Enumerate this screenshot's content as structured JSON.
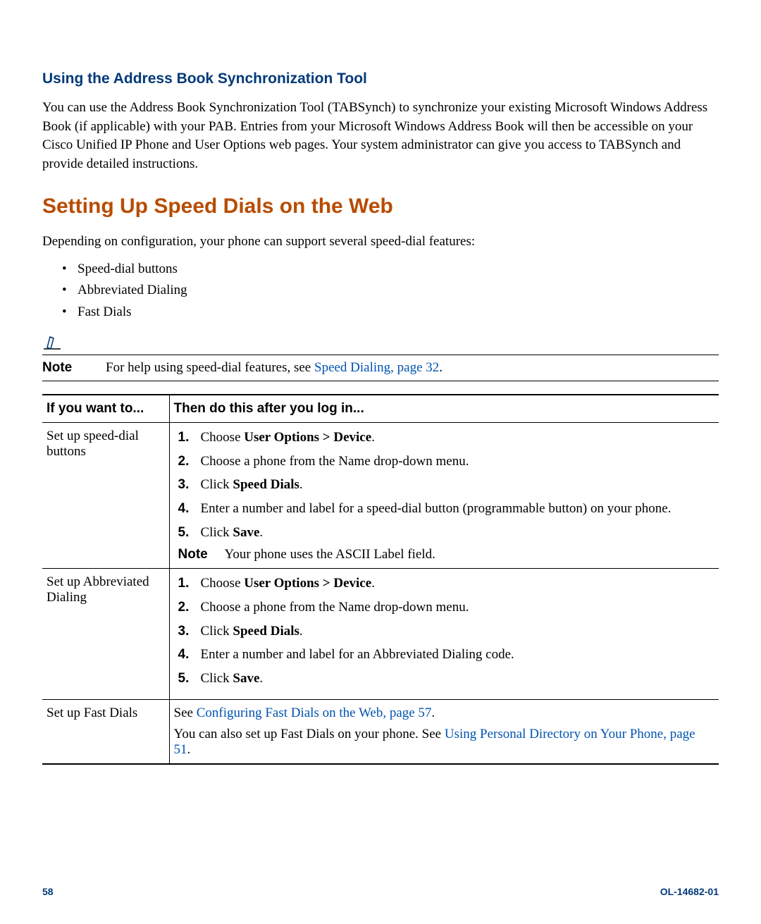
{
  "section1": {
    "title": "Using the Address Book Synchronization Tool",
    "body": "You can use the Address Book Synchronization Tool (TABSynch) to synchronize your existing Microsoft Windows Address Book (if applicable) with your PAB. Entries from your Microsoft Windows Address Book will then be accessible on your Cisco Unified IP Phone and User Options web pages. Your system administrator can give you access to TABSynch and provide detailed instructions."
  },
  "section2": {
    "title": "Setting Up Speed Dials on the Web",
    "lead": "Depending on configuration, your phone can support several speed-dial features:",
    "bullets": [
      "Speed-dial buttons",
      "Abbreviated Dialing",
      "Fast Dials"
    ]
  },
  "note": {
    "label": "Note",
    "text_pre": "For help using speed-dial features, see ",
    "link": "Speed Dialing, page 32",
    "text_post": "."
  },
  "table": {
    "header": {
      "col1": "If you want to...",
      "col2": "Then do this after you log in..."
    },
    "row1": {
      "left": "Set up speed-dial buttons",
      "step1_pre": "Choose ",
      "step1_bold": "User Options > Device",
      "step1_post": ".",
      "step2": "Choose a phone from the Name drop-down menu.",
      "step3_pre": "Click ",
      "step3_bold": "Speed Dials",
      "step3_post": ".",
      "step4": "Enter a number and label for a speed-dial button (programmable button) on your phone.",
      "step5_pre": "Click ",
      "step5_bold": "Save",
      "step5_post": ".",
      "note_label": "Note",
      "note_text": "Your phone uses the ASCII Label field."
    },
    "row2": {
      "left": "Set up Abbreviated Dialing",
      "step1_pre": "Choose ",
      "step1_bold": "User Options > Device",
      "step1_post": ".",
      "step2": "Choose a phone from the Name drop-down menu.",
      "step3_pre": "Click ",
      "step3_bold": "Speed Dials",
      "step3_post": ".",
      "step4": "Enter a number and label for an Abbreviated Dialing code.",
      "step5_pre": "Click ",
      "step5_bold": "Save",
      "step5_post": "."
    },
    "row3": {
      "left": "Set up Fast Dials",
      "line1_pre": "See ",
      "line1_link": "Configuring Fast Dials on the Web, page 57",
      "line1_post": ".",
      "line2_pre": "You can also set up Fast Dials on your phone. See ",
      "line2_link": "Using Personal Directory on Your Phone, page 51",
      "line2_post": "."
    }
  },
  "footer": {
    "page": "58",
    "doc_id": "OL-14682-01"
  }
}
